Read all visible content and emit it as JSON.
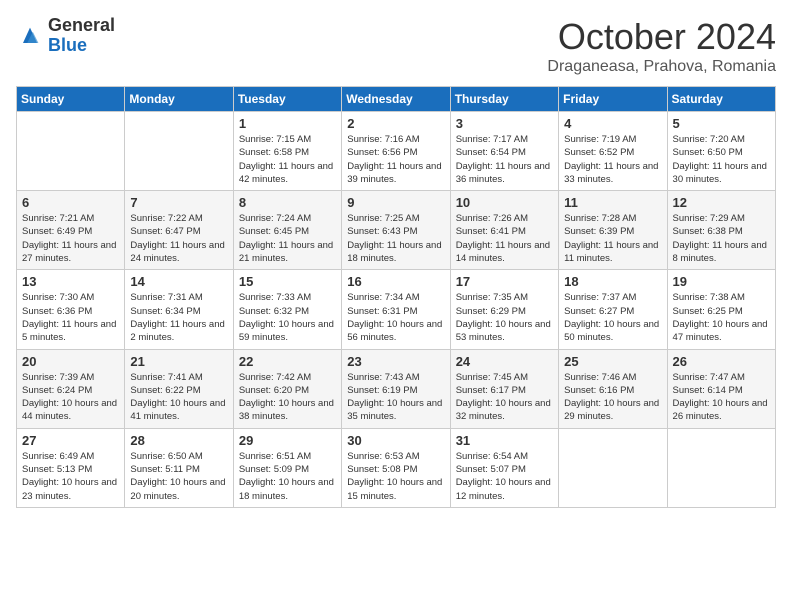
{
  "header": {
    "logo_general": "General",
    "logo_blue": "Blue",
    "title": "October 2024",
    "location": "Draganeasa, Prahova, Romania"
  },
  "days_of_week": [
    "Sunday",
    "Monday",
    "Tuesday",
    "Wednesday",
    "Thursday",
    "Friday",
    "Saturday"
  ],
  "weeks": [
    [
      {
        "day": "",
        "info": ""
      },
      {
        "day": "",
        "info": ""
      },
      {
        "day": "1",
        "info": "Sunrise: 7:15 AM\nSunset: 6:58 PM\nDaylight: 11 hours and 42 minutes."
      },
      {
        "day": "2",
        "info": "Sunrise: 7:16 AM\nSunset: 6:56 PM\nDaylight: 11 hours and 39 minutes."
      },
      {
        "day": "3",
        "info": "Sunrise: 7:17 AM\nSunset: 6:54 PM\nDaylight: 11 hours and 36 minutes."
      },
      {
        "day": "4",
        "info": "Sunrise: 7:19 AM\nSunset: 6:52 PM\nDaylight: 11 hours and 33 minutes."
      },
      {
        "day": "5",
        "info": "Sunrise: 7:20 AM\nSunset: 6:50 PM\nDaylight: 11 hours and 30 minutes."
      }
    ],
    [
      {
        "day": "6",
        "info": "Sunrise: 7:21 AM\nSunset: 6:49 PM\nDaylight: 11 hours and 27 minutes."
      },
      {
        "day": "7",
        "info": "Sunrise: 7:22 AM\nSunset: 6:47 PM\nDaylight: 11 hours and 24 minutes."
      },
      {
        "day": "8",
        "info": "Sunrise: 7:24 AM\nSunset: 6:45 PM\nDaylight: 11 hours and 21 minutes."
      },
      {
        "day": "9",
        "info": "Sunrise: 7:25 AM\nSunset: 6:43 PM\nDaylight: 11 hours and 18 minutes."
      },
      {
        "day": "10",
        "info": "Sunrise: 7:26 AM\nSunset: 6:41 PM\nDaylight: 11 hours and 14 minutes."
      },
      {
        "day": "11",
        "info": "Sunrise: 7:28 AM\nSunset: 6:39 PM\nDaylight: 11 hours and 11 minutes."
      },
      {
        "day": "12",
        "info": "Sunrise: 7:29 AM\nSunset: 6:38 PM\nDaylight: 11 hours and 8 minutes."
      }
    ],
    [
      {
        "day": "13",
        "info": "Sunrise: 7:30 AM\nSunset: 6:36 PM\nDaylight: 11 hours and 5 minutes."
      },
      {
        "day": "14",
        "info": "Sunrise: 7:31 AM\nSunset: 6:34 PM\nDaylight: 11 hours and 2 minutes."
      },
      {
        "day": "15",
        "info": "Sunrise: 7:33 AM\nSunset: 6:32 PM\nDaylight: 10 hours and 59 minutes."
      },
      {
        "day": "16",
        "info": "Sunrise: 7:34 AM\nSunset: 6:31 PM\nDaylight: 10 hours and 56 minutes."
      },
      {
        "day": "17",
        "info": "Sunrise: 7:35 AM\nSunset: 6:29 PM\nDaylight: 10 hours and 53 minutes."
      },
      {
        "day": "18",
        "info": "Sunrise: 7:37 AM\nSunset: 6:27 PM\nDaylight: 10 hours and 50 minutes."
      },
      {
        "day": "19",
        "info": "Sunrise: 7:38 AM\nSunset: 6:25 PM\nDaylight: 10 hours and 47 minutes."
      }
    ],
    [
      {
        "day": "20",
        "info": "Sunrise: 7:39 AM\nSunset: 6:24 PM\nDaylight: 10 hours and 44 minutes."
      },
      {
        "day": "21",
        "info": "Sunrise: 7:41 AM\nSunset: 6:22 PM\nDaylight: 10 hours and 41 minutes."
      },
      {
        "day": "22",
        "info": "Sunrise: 7:42 AM\nSunset: 6:20 PM\nDaylight: 10 hours and 38 minutes."
      },
      {
        "day": "23",
        "info": "Sunrise: 7:43 AM\nSunset: 6:19 PM\nDaylight: 10 hours and 35 minutes."
      },
      {
        "day": "24",
        "info": "Sunrise: 7:45 AM\nSunset: 6:17 PM\nDaylight: 10 hours and 32 minutes."
      },
      {
        "day": "25",
        "info": "Sunrise: 7:46 AM\nSunset: 6:16 PM\nDaylight: 10 hours and 29 minutes."
      },
      {
        "day": "26",
        "info": "Sunrise: 7:47 AM\nSunset: 6:14 PM\nDaylight: 10 hours and 26 minutes."
      }
    ],
    [
      {
        "day": "27",
        "info": "Sunrise: 6:49 AM\nSunset: 5:13 PM\nDaylight: 10 hours and 23 minutes."
      },
      {
        "day": "28",
        "info": "Sunrise: 6:50 AM\nSunset: 5:11 PM\nDaylight: 10 hours and 20 minutes."
      },
      {
        "day": "29",
        "info": "Sunrise: 6:51 AM\nSunset: 5:09 PM\nDaylight: 10 hours and 18 minutes."
      },
      {
        "day": "30",
        "info": "Sunrise: 6:53 AM\nSunset: 5:08 PM\nDaylight: 10 hours and 15 minutes."
      },
      {
        "day": "31",
        "info": "Sunrise: 6:54 AM\nSunset: 5:07 PM\nDaylight: 10 hours and 12 minutes."
      },
      {
        "day": "",
        "info": ""
      },
      {
        "day": "",
        "info": ""
      }
    ]
  ]
}
